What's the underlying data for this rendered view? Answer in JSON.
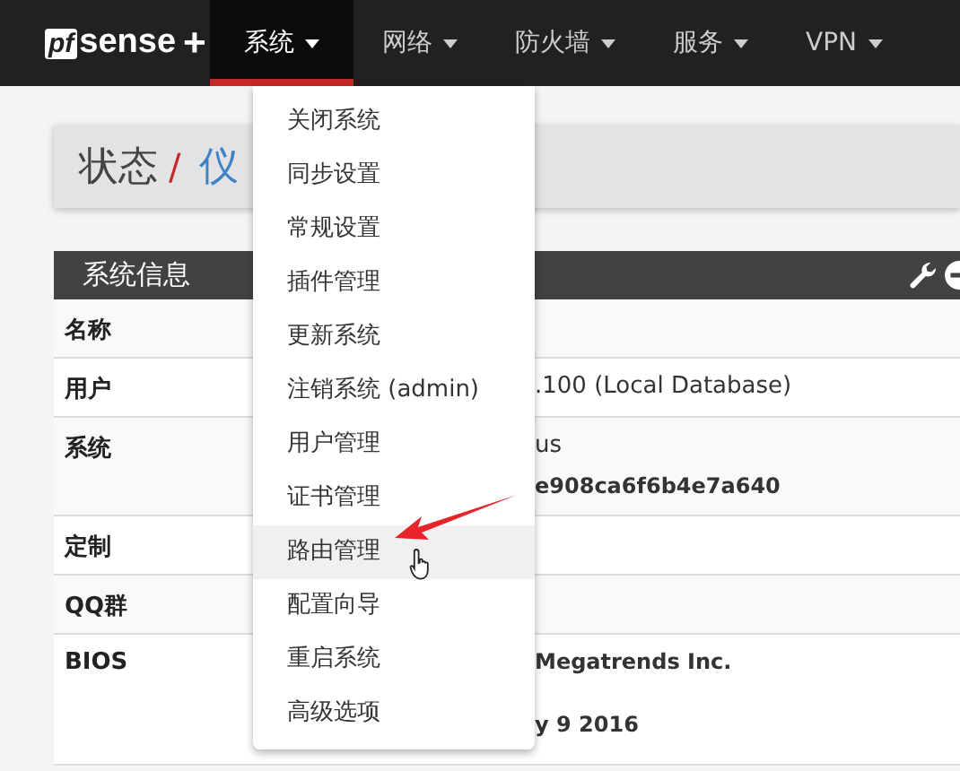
{
  "navbar": {
    "logo": {
      "mark": "pf",
      "word": "sense",
      "suffix": "+"
    },
    "items": [
      {
        "label": "系统",
        "selected": true
      },
      {
        "label": "网络",
        "selected": false
      },
      {
        "label": "防火墙",
        "selected": false
      },
      {
        "label": "服务",
        "selected": false
      },
      {
        "label": "VPN",
        "selected": false
      }
    ]
  },
  "breadcrumb": {
    "parent": "状态",
    "separator": "/",
    "current": "仪"
  },
  "panel": {
    "title": "系统信息",
    "rows": [
      {
        "label": "名称",
        "values": []
      },
      {
        "label": "用户",
        "values": [
          {
            "text": ".100 (Local Database)",
            "bold": false
          }
        ]
      },
      {
        "label": "系统",
        "values": [
          {
            "text": "us",
            "bold": false
          },
          {
            "text": "e908ca6f6b4e7a640",
            "bold": true
          }
        ]
      },
      {
        "label": "定制",
        "values": []
      },
      {
        "label": "QQ群",
        "values": []
      },
      {
        "label": "BIOS",
        "values": [
          {
            "text": "Megatrends Inc.",
            "bold": true
          },
          {
            "text": "y 9 2016",
            "bold": true
          }
        ]
      }
    ]
  },
  "dropdown": {
    "items": [
      {
        "label": "关闭系统",
        "selected": false
      },
      {
        "label": "同步设置",
        "selected": false
      },
      {
        "label": "常规设置",
        "selected": false
      },
      {
        "label": "插件管理",
        "selected": false
      },
      {
        "label": "更新系统",
        "selected": false
      },
      {
        "label": "注销系统 (admin)",
        "selected": false
      },
      {
        "label": "用户管理",
        "selected": false
      },
      {
        "label": "证书管理",
        "selected": false
      },
      {
        "label": "路由管理",
        "selected": true
      },
      {
        "label": "配置向导",
        "selected": false
      },
      {
        "label": "重启系统",
        "selected": false
      },
      {
        "label": "高级选项",
        "selected": false
      }
    ]
  }
}
